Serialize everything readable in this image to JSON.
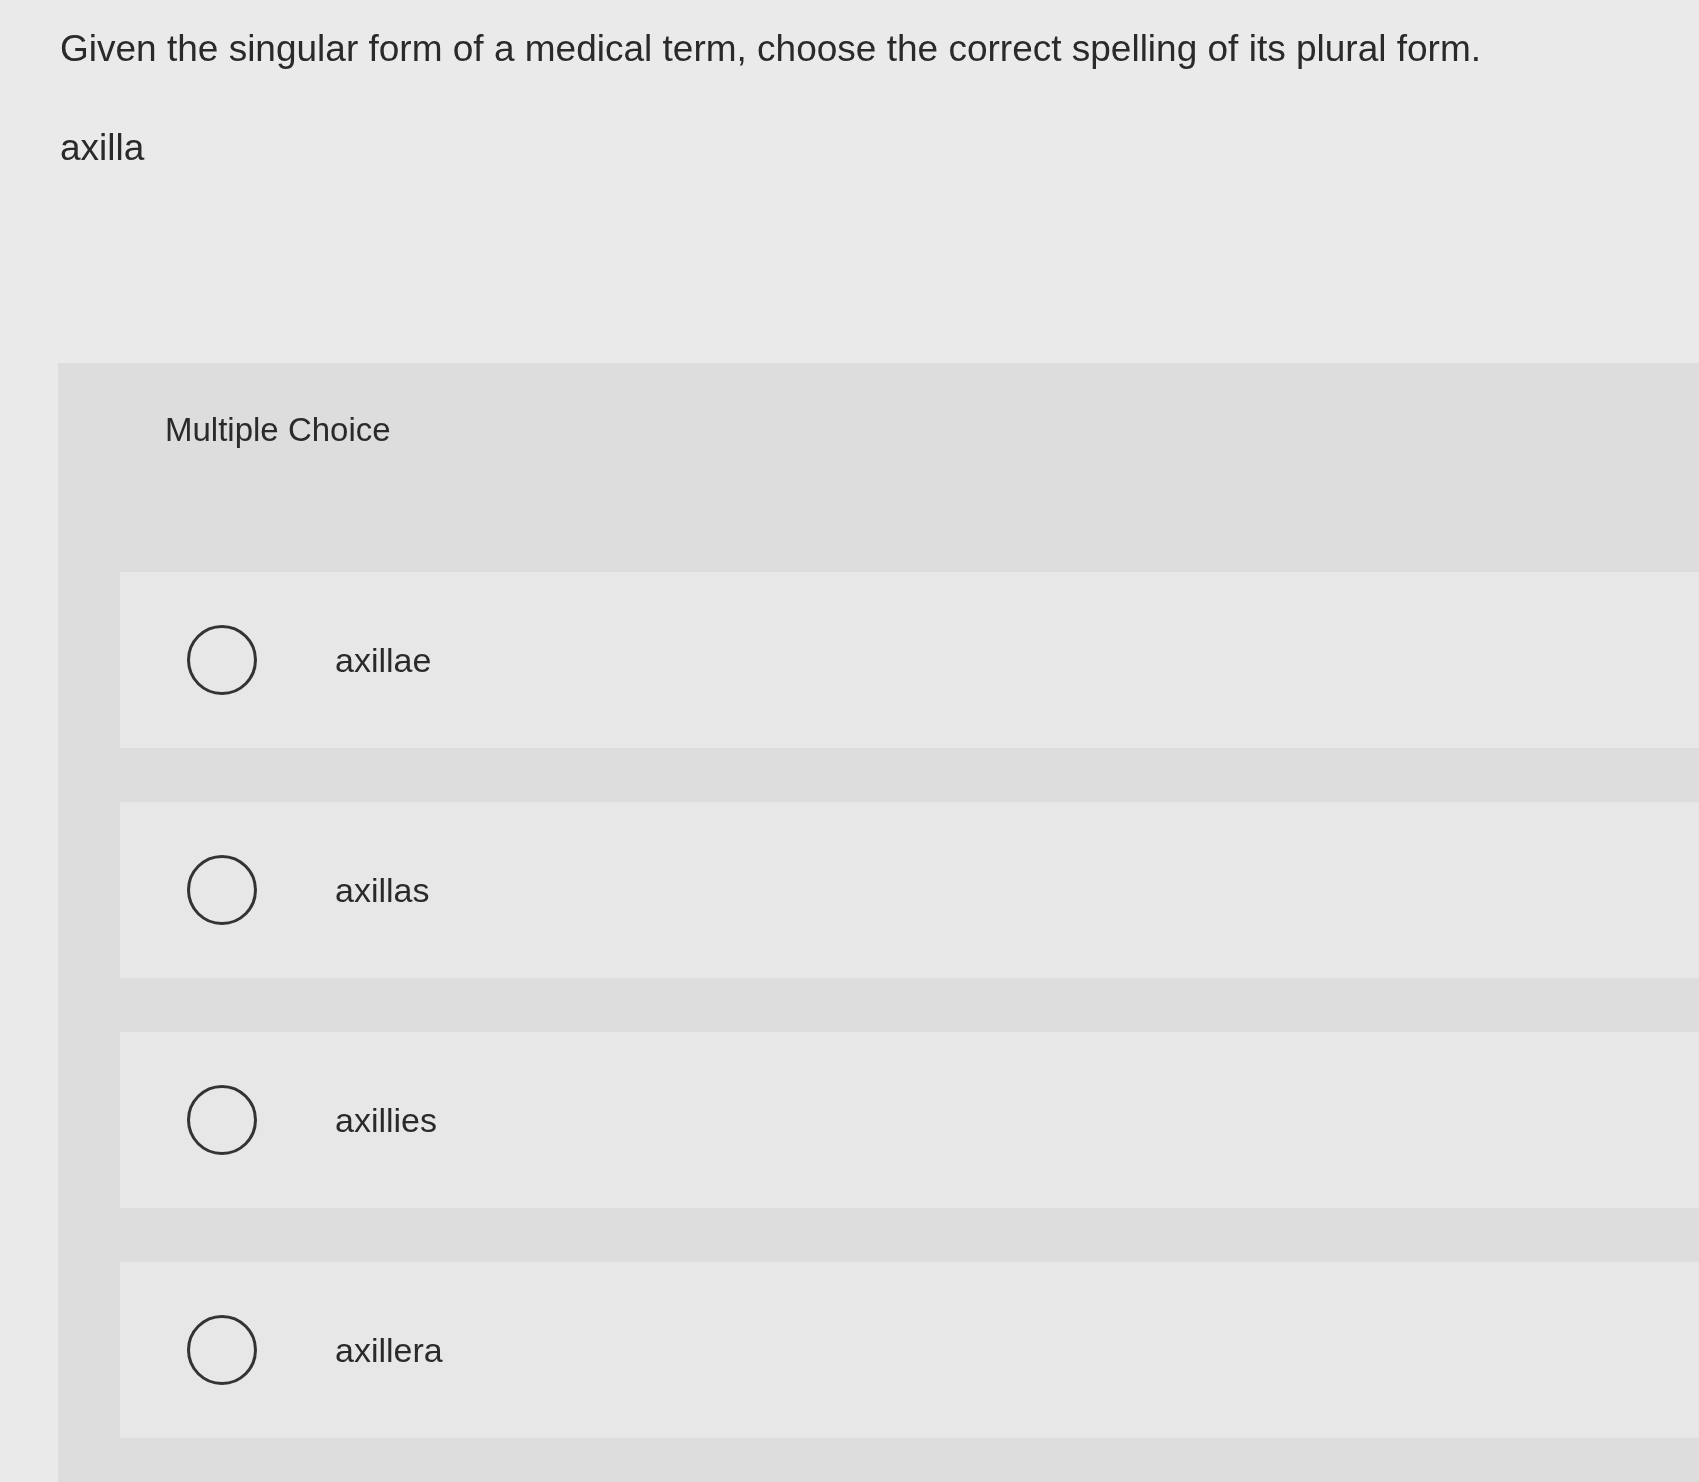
{
  "question": {
    "prompt": "Given the singular form of a medical term, choose the correct spelling of its plural form.",
    "term": "axilla"
  },
  "multiple_choice": {
    "title": "Multiple Choice",
    "options": [
      {
        "label": "axillae",
        "selected": false
      },
      {
        "label": "axillas",
        "selected": false
      },
      {
        "label": "axillies",
        "selected": false
      },
      {
        "label": "axillera",
        "selected": false
      }
    ]
  }
}
